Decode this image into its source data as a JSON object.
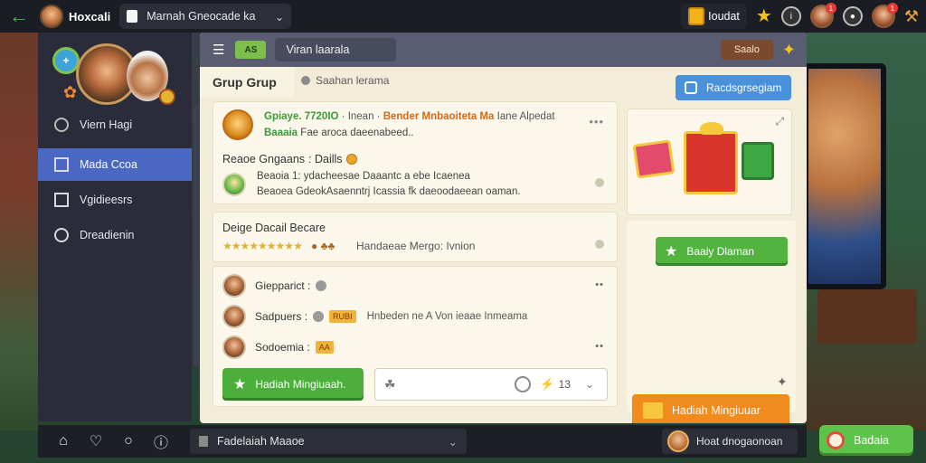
{
  "colors": {
    "accent_blue": "#4a68c2",
    "green": "#4caf3c",
    "orange": "#f08c1e",
    "panel_bg": "#f3ecd8",
    "topbar_bg": "#1b1d24"
  },
  "topbar": {
    "app_title": "Hoxcali",
    "tab_label": "Marnah Gneocade ka",
    "coins_label": "Ioudat",
    "notif_count_1": "1",
    "notif_count_2": "1"
  },
  "sidebar": {
    "items": [
      {
        "label": "Viern Hagi",
        "icon": "clock-icon"
      },
      {
        "label": "Mada Ccoa",
        "icon": "square-icon"
      },
      {
        "label": "Vgidieesrs",
        "icon": "square-icon"
      },
      {
        "label": "Dreadienin",
        "icon": "circle-icon"
      }
    ]
  },
  "panel": {
    "top_chip": "AS",
    "title": "Viran laarala",
    "top_badge": "Saalo",
    "group_tab": "Grup Grup",
    "search_label": "Saahan lerama",
    "blue_button": "Racdsgrsegiam",
    "card1": {
      "headline_green": "Gpiaye. 7720IO",
      "headline_mid": "· Inean ·",
      "headline_orange": "Bender Mnbaoiteta Ma",
      "headline_tail": "Iane Alpedat",
      "sub_green": "Baaaia",
      "sub_text": "Fae aroca daeenabeed..",
      "title2": "Reaoe Gngaans",
      "title2_tail": ": Daills",
      "body_line1": "Beaoia 1: ydacheesae Daaantc a ebe Icaenea",
      "body_line2": "Beaoea GdeokAsaenntrj Icassia fk daeoodaeean oaman."
    },
    "card2": {
      "title": "Deige Dacail Becare",
      "stars": "★★★★★★★★★",
      "extra": "● ♣♣",
      "sub": "Handaeae Mergo: Ivnion"
    },
    "card3": {
      "friends": [
        {
          "name": "Giepparict :",
          "chip": "",
          "extra": ""
        },
        {
          "name": "Sadpuers :",
          "chip": "RUBI",
          "extra": "Hnbeden ne A Von ieaae Inmeama"
        },
        {
          "name": "Sodoemia :",
          "chip": "AA",
          "extra": ""
        }
      ],
      "green_button": "Hadiah Mingiuaah.",
      "counter": "13"
    },
    "right": {
      "green_button": "Baaiy Dlaman",
      "orange_button": "Hadiah Mingiuuar"
    }
  },
  "bottombar": {
    "select_label": "Fadelaiah Maaoe",
    "user_label": "Hoat dnogaonoan"
  },
  "corner_badge": "Badaia"
}
